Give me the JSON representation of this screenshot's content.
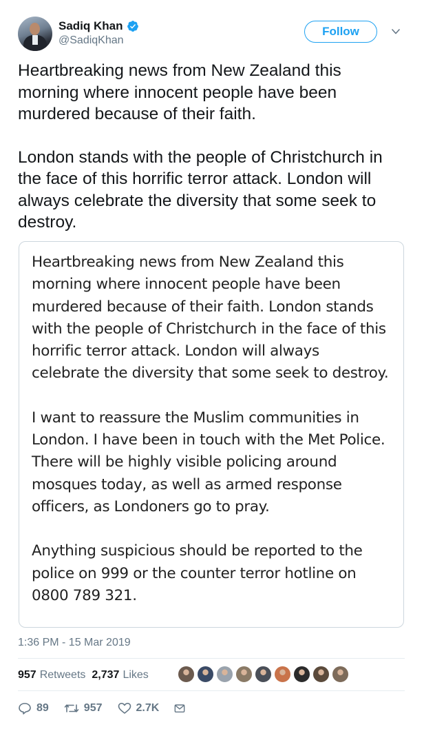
{
  "author": {
    "display_name": "Sadiq Khan",
    "handle": "@SadiqKhan",
    "verified_icon": "verified-badge-icon"
  },
  "header": {
    "follow_label": "Follow",
    "menu_icon": "chevron-down-icon"
  },
  "tweet": {
    "paragraphs": [
      "Heartbreaking news from New Zealand this morning where innocent people have been murdered because of their faith.",
      "London stands with the people of Christchurch in the face of this horrific terror attack. London will always celebrate the diversity that some seek to destroy."
    ]
  },
  "quoted_statement": {
    "paragraphs": [
      "Heartbreaking news from New Zealand this morning where innocent people have been murdered because of their faith. London stands with the people of Christchurch in the face of this horrific terror attack. London will always celebrate the diversity that some seek to destroy.",
      "I want to reassure the Muslim communities in London. I have been in touch with the Met Police. There will be highly visible policing around mosques today, as well as armed response officers, as Londoners go to pray.",
      "Anything suspicious should be reported to the police on 999 or the counter terror hotline on 0800 789 321."
    ]
  },
  "timestamp": "1:36 PM - 15 Mar 2019",
  "stats": {
    "retweets_count": "957",
    "retweets_label": "Retweets",
    "likes_count": "2,737",
    "likes_label": "Likes"
  },
  "actions": {
    "reply_count": "89",
    "retweet_count": "957",
    "like_count": "2.7K",
    "reply_icon": "reply-icon",
    "retweet_icon": "retweet-icon",
    "like_icon": "heart-icon",
    "message_icon": "envelope-icon"
  },
  "colors": {
    "accent": "#1da1f2",
    "text": "#14171a",
    "muted": "#657786",
    "border": "#ccd6dd"
  },
  "liker_avatar_colors": [
    "#6b5a4e",
    "#3a4a66",
    "#9aa3ad",
    "#8a7a66",
    "#4a4f58",
    "#c9734a",
    "#2b2b2b",
    "#5b4a3b",
    "#7d6b5a"
  ]
}
